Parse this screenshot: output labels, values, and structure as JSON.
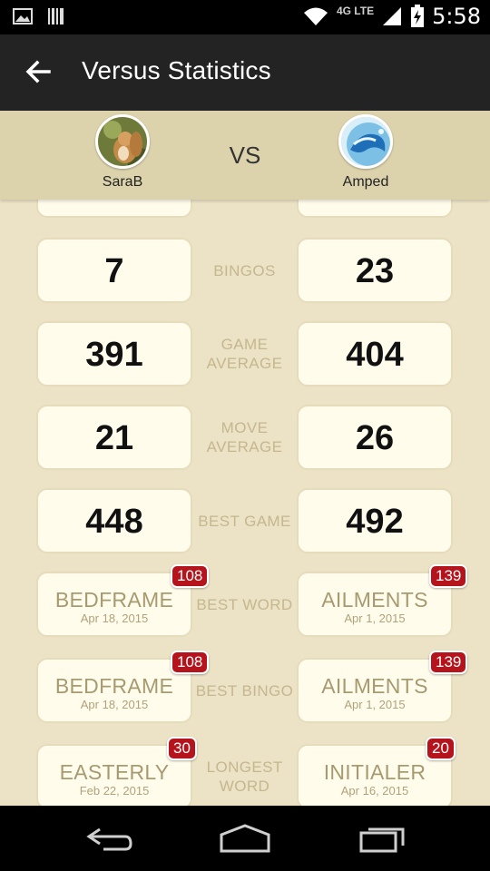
{
  "status_bar": {
    "time": "5:58",
    "network": "4G LTE"
  },
  "app_bar": {
    "title": "Versus Statistics"
  },
  "players": {
    "left": {
      "name": "SaraB"
    },
    "right": {
      "name": "Amped"
    },
    "vs_label": "VS"
  },
  "stats": [
    {
      "label": "BINGOS",
      "left": "7",
      "right": "23"
    },
    {
      "label": "GAME AVERAGE",
      "left": "391",
      "right": "404"
    },
    {
      "label": "MOVE AVERAGE",
      "left": "21",
      "right": "26"
    },
    {
      "label": "BEST GAME",
      "left": "448",
      "right": "492"
    }
  ],
  "word_stats": [
    {
      "label": "BEST WORD",
      "left": {
        "word": "BEDFRAME",
        "date": "Apr 18, 2015",
        "score": "108"
      },
      "right": {
        "word": "AILMENTS",
        "date": "Apr 1, 2015",
        "score": "139"
      }
    },
    {
      "label": "BEST BINGO",
      "left": {
        "word": "BEDFRAME",
        "date": "Apr 18, 2015",
        "score": "108"
      },
      "right": {
        "word": "AILMENTS",
        "date": "Apr 1, 2015",
        "score": "139"
      }
    },
    {
      "label": "LONGEST WORD",
      "left": {
        "word": "EASTERLY",
        "date": "Feb 22, 2015",
        "score": "30"
      },
      "right": {
        "word": "INITIALER",
        "date": "Apr 16, 2015",
        "score": "20"
      }
    }
  ],
  "colors": {
    "background": "#ece3c6",
    "header": "#dcd3ad",
    "app_bar": "#232323",
    "badge": "#b5141c",
    "label": "#c5b78e"
  }
}
